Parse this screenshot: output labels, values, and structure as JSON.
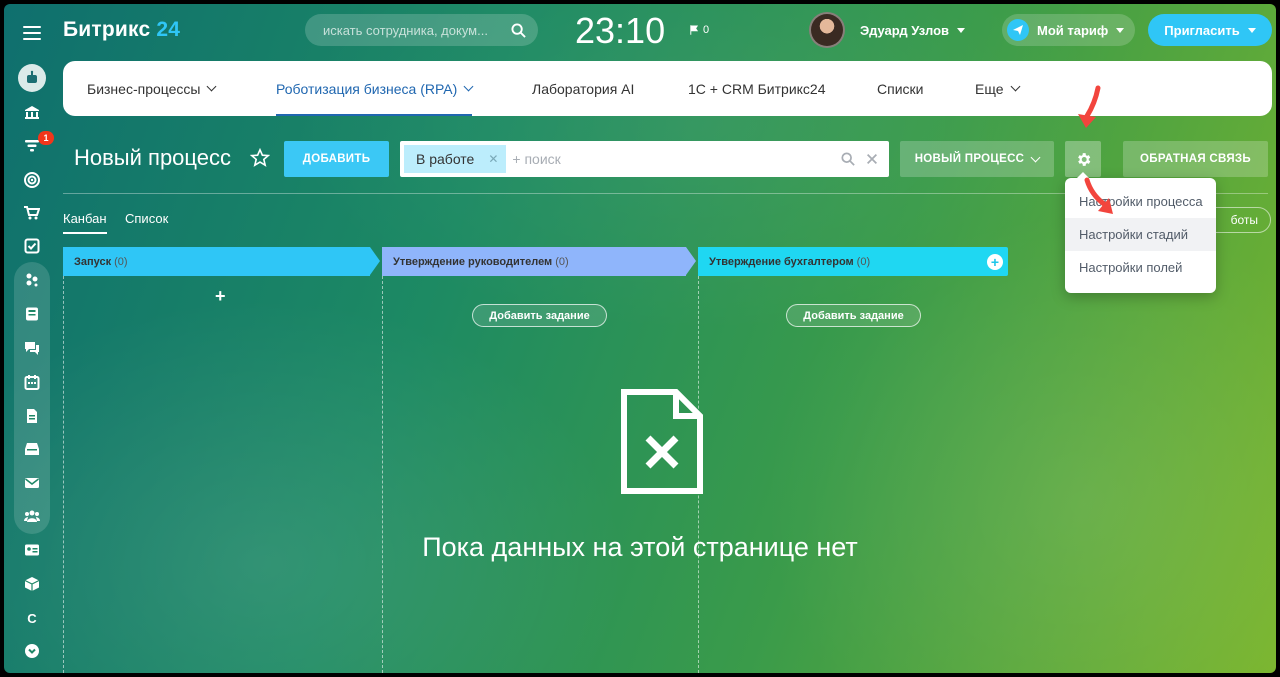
{
  "app": {
    "logo_text": "Битрикс",
    "logo_num": "24",
    "search_placeholder": "искать сотрудника, докум...",
    "clock": "23:10",
    "flag_count": "0",
    "user_name": "Эдуард Узлов",
    "tariff_label": "Мой тариф",
    "invite_label": "Пригласить",
    "accent_color": "#2fc6f6"
  },
  "sidebar": {
    "notification_badge": "1",
    "letter_item": "C",
    "icons": [
      "robot-icon",
      "building-icon",
      "funnel-icon",
      "target-icon",
      "cart-icon",
      "checkbox-icon",
      "apps-icon",
      "news-icon",
      "chat-icon",
      "calendar-icon",
      "document-icon",
      "inbox-icon",
      "mail-icon",
      "team-icon",
      "id-card-icon",
      "box-icon",
      "letter-c-icon",
      "chevron-down-icon"
    ]
  },
  "nav": {
    "items": [
      {
        "label": "Бизнес-процессы",
        "has_dropdown": true,
        "active": false
      },
      {
        "label": "Роботизация бизнеса (RPA)",
        "has_dropdown": true,
        "active": true
      },
      {
        "label": "Лаборатория AI",
        "has_dropdown": false,
        "active": false
      },
      {
        "label": "1С + CRM Битрикс24",
        "has_dropdown": false,
        "active": false
      },
      {
        "label": "Списки",
        "has_dropdown": false,
        "active": false
      },
      {
        "label": "Еще",
        "has_dropdown": true,
        "active": false
      }
    ]
  },
  "toolbar": {
    "page_title": "Новый процесс",
    "add_button": "ДОБАВИТЬ",
    "filter_chip": "В работе",
    "filter_placeholder": "+ поиск",
    "new_process_button": "НОВЫЙ ПРОЦЕСС",
    "feedback_button": "ОБРАТНАЯ СВЯЗЬ"
  },
  "views": {
    "tabs": [
      "Канбан",
      "Список"
    ],
    "active": "Канбан",
    "right_button_visible_text": "боты"
  },
  "kanban": {
    "columns": [
      {
        "name": "Запуск",
        "count": "(0)",
        "color": "#2fc6f6"
      },
      {
        "name": "Утверждение руководителем",
        "count": "(0)",
        "color": "#8fb5fb"
      },
      {
        "name": "Утверждение бухгалтером",
        "count": "(0)",
        "color": "#1fd7f2"
      }
    ],
    "add_task_label": "Добавить задание",
    "plus": "+"
  },
  "empty_state": {
    "text": "Пока данных на этой странице нет"
  },
  "settings_menu": {
    "items": [
      "Настройки процесса",
      "Настройки стадий",
      "Настройки полей"
    ],
    "highlighted": "Настройки стадий"
  }
}
